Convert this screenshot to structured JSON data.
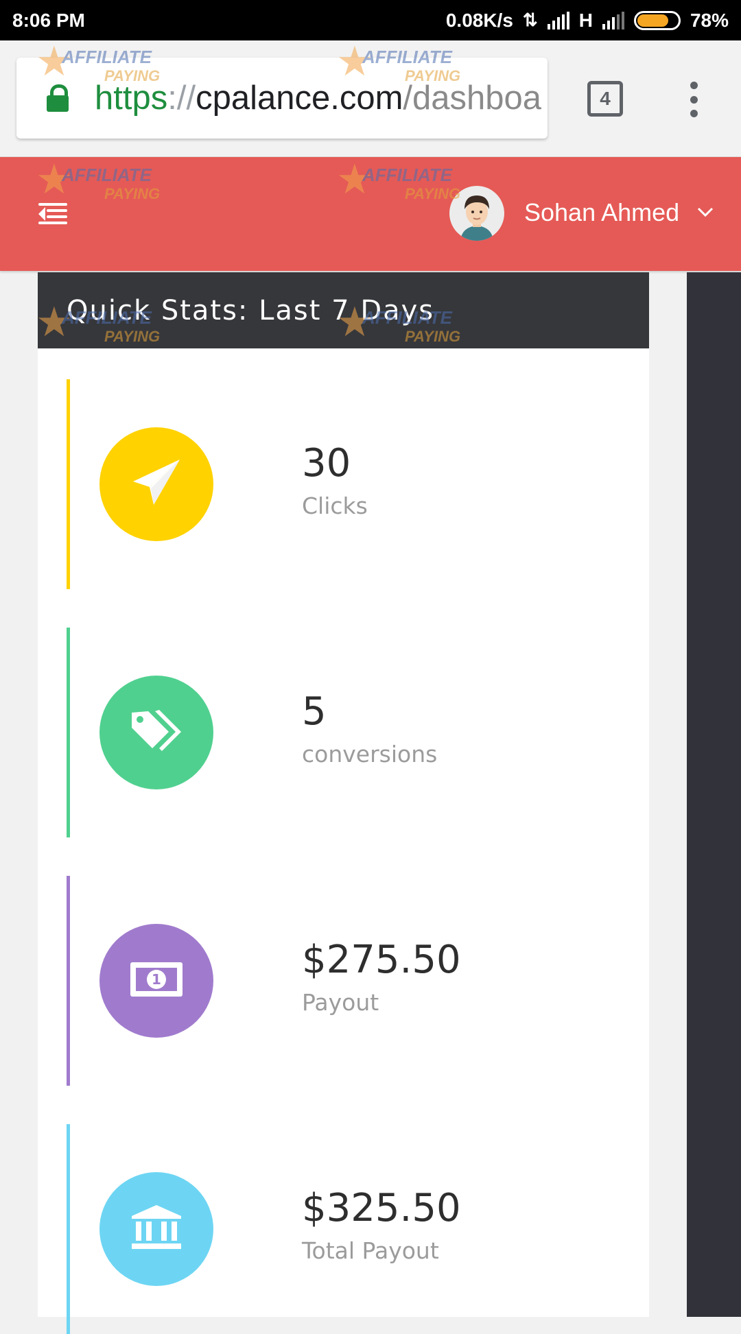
{
  "status_bar": {
    "time": "8:06 PM",
    "net_speed": "0.08K/s",
    "network_type": "H",
    "battery_percent": "78%",
    "battery_level": 0.78
  },
  "browser": {
    "url_scheme": "https",
    "url_separator": "://",
    "url_host": "cpalance.com",
    "url_path": "/dashboa",
    "tab_count": "4",
    "secure_icon": "lock-icon",
    "menu_icon": "more-vert-icon"
  },
  "watermark": {
    "line1": "AFFILIATE",
    "line2": "PAYING"
  },
  "header": {
    "menu_icon": "menu-collapse-icon",
    "user_name": "Sohan Ahmed",
    "dropdown_icon": "chevron-down-icon",
    "accent_color": "#e55a56"
  },
  "panel": {
    "title": "Quick Stats: Last 7 Days",
    "stats": [
      {
        "value": "30",
        "label": "Clicks",
        "icon": "paper-plane-icon",
        "color": "#ffd200"
      },
      {
        "value": "5",
        "label": "conversions",
        "icon": "tags-icon",
        "color": "#50d08f"
      },
      {
        "value": "$275.50",
        "label": "Payout",
        "icon": "money-bill-icon",
        "color": "#a07bcd"
      },
      {
        "value": "$325.50",
        "label": "Total Payout",
        "icon": "bank-icon",
        "color": "#6dd5f3"
      }
    ]
  }
}
